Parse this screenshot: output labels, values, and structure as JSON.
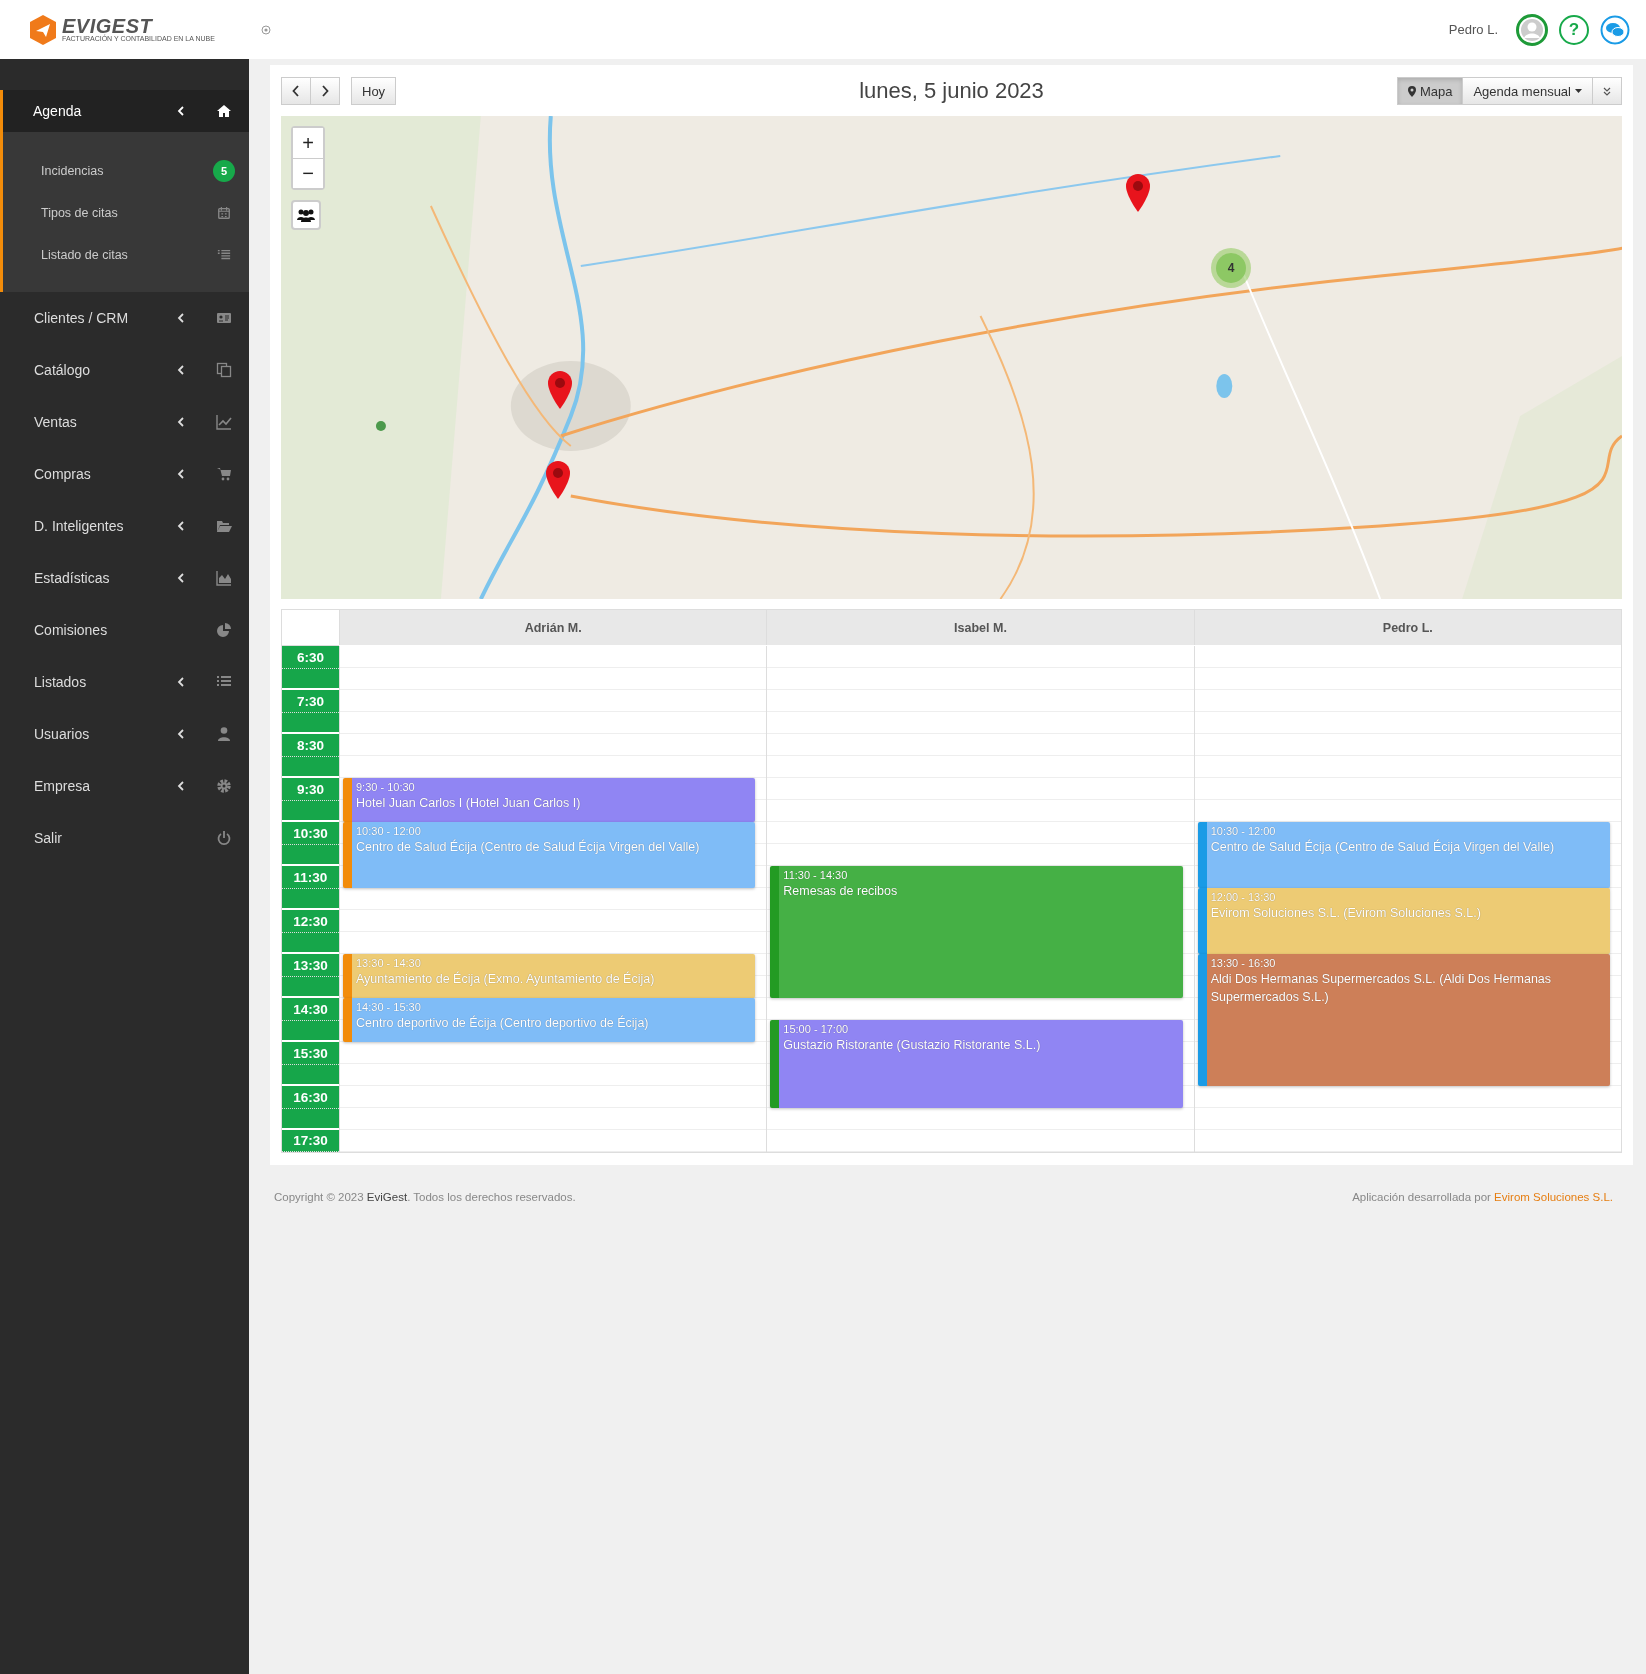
{
  "header": {
    "logo": "EVIGEST",
    "tagline": "FACTURACIÓN Y CONTABILIDAD EN LA NUBE",
    "user": "Pedro L.",
    "help": "?"
  },
  "sidebar": {
    "items": [
      {
        "label": "Agenda",
        "chevron": true,
        "expanded": true,
        "children": [
          {
            "label": "Incidencias",
            "badge": "5"
          },
          {
            "label": "Tipos de citas"
          },
          {
            "label": "Listado de citas"
          }
        ]
      },
      {
        "label": "Clientes / CRM",
        "chevron": true,
        "expanded": false
      },
      {
        "label": "Catálogo",
        "chevron": true,
        "expanded": false
      },
      {
        "label": "Ventas",
        "chevron": true,
        "expanded": false
      },
      {
        "label": "Compras",
        "chevron": true,
        "expanded": false
      },
      {
        "label": "D. Inteligentes",
        "chevron": true,
        "expanded": false
      },
      {
        "label": "Estadísticas",
        "chevron": true,
        "expanded": false
      },
      {
        "label": "Comisiones",
        "chevron": false,
        "expanded": false
      },
      {
        "label": "Listados",
        "chevron": true,
        "expanded": false
      },
      {
        "label": "Usuarios",
        "chevron": true,
        "expanded": false
      },
      {
        "label": "Empresa",
        "chevron": true,
        "expanded": false
      },
      {
        "label": "Salir",
        "chevron": false,
        "expanded": false
      }
    ]
  },
  "toolbar": {
    "today": "Hoy",
    "title": "lunes, 5 junio 2023",
    "views": [
      {
        "label": "Mapa",
        "selected": true
      },
      {
        "label": "Agenda mensual",
        "selected": false
      }
    ]
  },
  "map": {
    "cluster": "4",
    "zoom_in": "+",
    "zoom_out": "−"
  },
  "calendar": {
    "times": [
      "6:30",
      "7:30",
      "8:30",
      "9:30",
      "10:30",
      "11:30",
      "12:30",
      "13:30",
      "14:30",
      "15:30",
      "16:30",
      "17:30"
    ],
    "columns": [
      {
        "name": "Adrián M.",
        "events": [
          {
            "time": "9:30 - 10:30",
            "title": "Hotel Juan Carlos I (Hotel Juan Carlos I)",
            "color": "#9085f3"
          },
          {
            "time": "10:30 - 12:00",
            "title": "Centro de Salud Écija (Centro de Salud Écija Virgen del Valle)",
            "color": "#7fbcf7"
          },
          {
            "time": "13:30 - 14:30",
            "title": "Ayuntamiento de Écija (Exmo. Ayuntamiento de Écija)",
            "color": "#edcb74"
          },
          {
            "time": "14:30 - 15:30",
            "title": "Centro deportivo de Écija (Centro deportivo de Écija)",
            "color": "#7fbcf7"
          }
        ]
      },
      {
        "name": "Isabel M.",
        "events": [
          {
            "time": "11:30 - 14:30",
            "title": "Remesas de recibos",
            "color": "#45b045"
          },
          {
            "time": "15:00 - 17:00",
            "title": "Gustazio Ristorante (Gustazio Ristorante S.L.)",
            "color": "#9085f3"
          }
        ]
      },
      {
        "name": "Pedro L.",
        "events": [
          {
            "time": "10:30 - 12:00",
            "title": "Centro de Salud Écija (Centro de Salud Écija Virgen del Valle)",
            "color": "#7fbcf7"
          },
          {
            "time": "12:00 - 13:30",
            "title": "Evirom Soluciones S.L. (Evirom Soluciones S.L.)",
            "color": "#edcb74"
          },
          {
            "time": "13:30 - 16:30",
            "title": "Aldi Dos Hermanas Supermercados S.L. (Aldi Dos Hermanas Supermercados S.L.)",
            "color": "#cd7f58"
          }
        ]
      }
    ]
  },
  "footer": {
    "copyright": "Copyright © 2023 **EviGest**. Todos los derechos reservados.",
    "credit": "Aplicación desarrollada por",
    "credit_link": "Evirom Soluciones S.L."
  }
}
